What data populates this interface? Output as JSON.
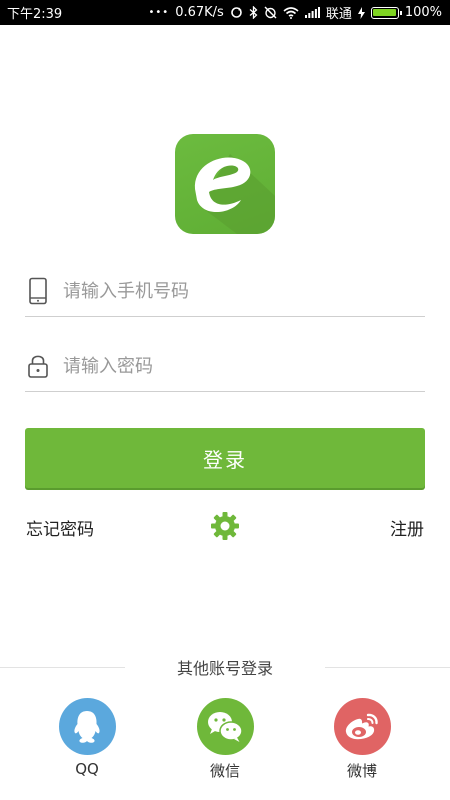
{
  "status_bar": {
    "time": "下午2:39",
    "dots": "•••",
    "network_speed": "0.67K/s",
    "carrier": "联通",
    "battery": "100%",
    "battery_level": 1.0
  },
  "login_form": {
    "phone_placeholder": "请输入手机号码",
    "password_placeholder": "请输入密码",
    "login_label": "登录",
    "forgot_password": "忘记密码",
    "register": "注册"
  },
  "other_login": {
    "title": "其他账号登录",
    "providers": [
      {
        "label": "QQ",
        "icon": "qq-icon",
        "color": "#5ba8dd"
      },
      {
        "label": "微信",
        "icon": "wechat-icon",
        "color": "#6fb83a"
      },
      {
        "label": "微博",
        "icon": "weibo-icon",
        "color": "#e06464"
      }
    ]
  },
  "colors": {
    "accent": "#6fb83a",
    "status_bar_bg": "#000000",
    "divider": "#cfcfcf"
  },
  "icons": {
    "logo": "app-logo-e",
    "phone_field": "phone-icon",
    "password_field": "lock-icon",
    "settings": "gear-icon"
  }
}
